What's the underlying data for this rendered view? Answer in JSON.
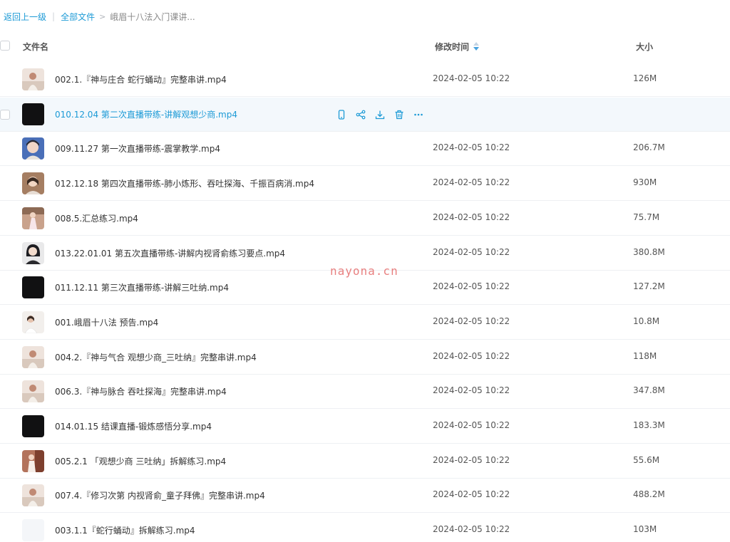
{
  "breadcrumb": {
    "back": "返回上一级",
    "separator": "|",
    "all_files": "全部文件",
    "arrow": ">",
    "current": "峨眉十八法入门课讲..."
  },
  "columns": {
    "name": "文件名",
    "modified": "修改时间",
    "size": "大小"
  },
  "files": [
    {
      "name": "002.1.『神与庄合 蛇行蛹动』完整串讲.mp4",
      "date": "2024-02-05 10:22",
      "size": "126M",
      "thumb": "person-light"
    },
    {
      "name": "010.12.04 第二次直播带练-讲解观想少商.mp4",
      "date": "",
      "size": "",
      "thumb": "dark",
      "hover": true
    },
    {
      "name": "009.11.27 第一次直播带练-震掌教学.mp4",
      "date": "2024-02-05 10:22",
      "size": "206.7M",
      "thumb": "person-blue"
    },
    {
      "name": "012.12.18 第四次直播带练-肺小炼形、吞吐探海、千振百病消.mp4",
      "date": "2024-02-05 10:22",
      "size": "930M",
      "thumb": "person-warm"
    },
    {
      "name": "008.5.汇总练习.mp4",
      "date": "2024-02-05 10:22",
      "size": "75.7M",
      "thumb": "person-pink"
    },
    {
      "name": "013.22.01.01 第五次直播带练-讲解内视肾俞练习要点.mp4",
      "date": "2024-02-05 10:22",
      "size": "380.8M",
      "thumb": "person-dark"
    },
    {
      "name": "011.12.11 第三次直播带练-讲解三吐纳.mp4",
      "date": "2024-02-05 10:22",
      "size": "127.2M",
      "thumb": "dark"
    },
    {
      "name": "001.峨眉十八法 预告.mp4",
      "date": "2024-02-05 10:22",
      "size": "10.8M",
      "thumb": "person-white"
    },
    {
      "name": "004.2.『神与气合 观想少商_三吐纳』完整串讲.mp4",
      "date": "2024-02-05 10:22",
      "size": "118M",
      "thumb": "person-light"
    },
    {
      "name": "006.3.『神与脉合 吞吐探海』完整串讲.mp4",
      "date": "2024-02-05 10:22",
      "size": "347.8M",
      "thumb": "person-light"
    },
    {
      "name": "014.01.15 结课直播-锻炼感悟分享.mp4",
      "date": "2024-02-05 10:22",
      "size": "183.3M",
      "thumb": "dark"
    },
    {
      "name": "005.2.1 「观想少商 三吐纳」拆解练习.mp4",
      "date": "2024-02-05 10:22",
      "size": "55.6M",
      "thumb": "person-red"
    },
    {
      "name": "007.4.『修习次第 内视肾俞_童子拜佛』完整串讲.mp4",
      "date": "2024-02-05 10:22",
      "size": "488.2M",
      "thumb": "person-light"
    },
    {
      "name": "003.1.1『蛇行蛹动』拆解练习.mp4",
      "date": "2024-02-05 10:22",
      "size": "103M",
      "thumb": "blank"
    }
  ],
  "hover_actions": [
    "phone-icon",
    "share-icon",
    "download-icon",
    "delete-icon",
    "more-icon"
  ],
  "watermark": "nayona.cn",
  "colors": {
    "link": "#1c9ad6",
    "hover_row": "#f3f8fc",
    "sort_arrow": "#4aa3df",
    "watermark": "#e46a6a"
  }
}
